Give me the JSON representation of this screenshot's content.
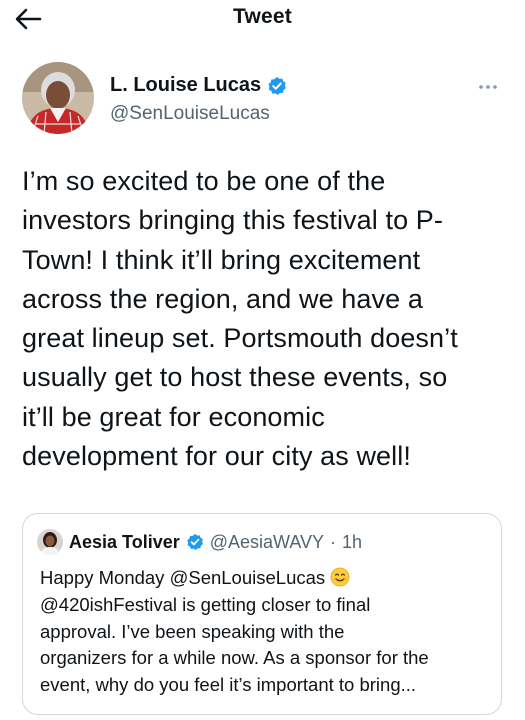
{
  "header": {
    "title": "Tweet"
  },
  "tweet": {
    "author_name": "L. Louise Lucas",
    "handle": "@SenLouiseLucas",
    "lines": [
      "I’m so excited to be one of the",
      "investors bringing this festival to P-",
      "Town! I think it’ll bring excitement",
      "across the region, and we have a",
      "great lineup set. Portsmouth doesn’t",
      "usually get to host these events, so",
      "it’ll be great for economic",
      "development for our city as well!"
    ]
  },
  "quote": {
    "author_name": "Aesia Toliver",
    "handle": "@AesiaWAVY",
    "separator": "·",
    "time": "1h",
    "line1": "Happy Monday @SenLouiseLucas",
    "lines": [
      "@420ishFestival is getting closer to final",
      "approval. I’ve been speaking with the",
      "organizers for a while now. As a sponsor for the",
      "event, why do you feel it’s important to bring..."
    ]
  },
  "colors": {
    "text": "#0f1419",
    "secondary": "#536471",
    "verified": "#1d9bf0",
    "border": "#cfd9de"
  },
  "icons": {
    "back": "arrow-left-icon",
    "verified": "verified-badge-icon",
    "more": "more-dots-icon",
    "emoji": "smiling-face-emoji"
  }
}
